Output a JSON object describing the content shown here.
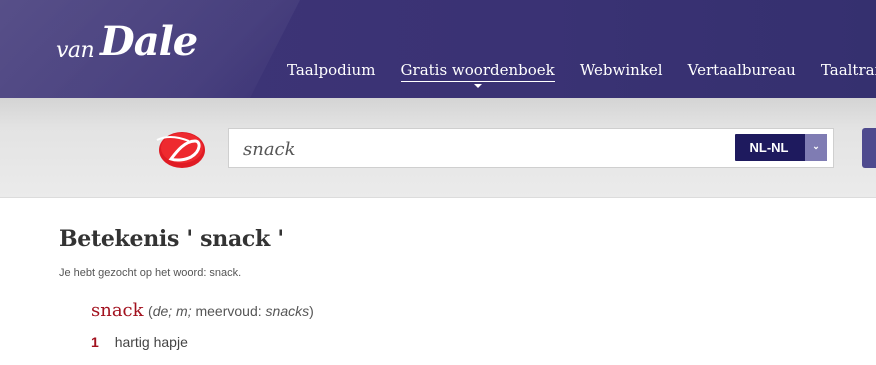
{
  "header": {
    "logo_small": "van",
    "logo_big": "Dale",
    "nav": [
      {
        "label": "Taalpodium",
        "active": false
      },
      {
        "label": "Gratis woordenboek",
        "active": true
      },
      {
        "label": "Webwinkel",
        "active": false
      },
      {
        "label": "Vertaalbureau",
        "active": false
      },
      {
        "label": "Taaltrainingen",
        "active": false
      }
    ]
  },
  "search": {
    "value": "snack",
    "language": "NL-NL",
    "dropdown_icon": "chevron-down-icon",
    "accent_color": "#1e1a5e"
  },
  "result": {
    "title": "Betekenis ' snack '",
    "note": "Je hebt gezocht op het woord: snack.",
    "headword": "snack",
    "grammar_open": "(",
    "grammar_gender": "de; m;",
    "grammar_plural_label": " meervoud: ",
    "grammar_plural": "snacks",
    "grammar_close": ")",
    "senses": [
      {
        "number": "1",
        "text": "hartig hapje"
      }
    ],
    "headword_color": "#a2111e"
  }
}
